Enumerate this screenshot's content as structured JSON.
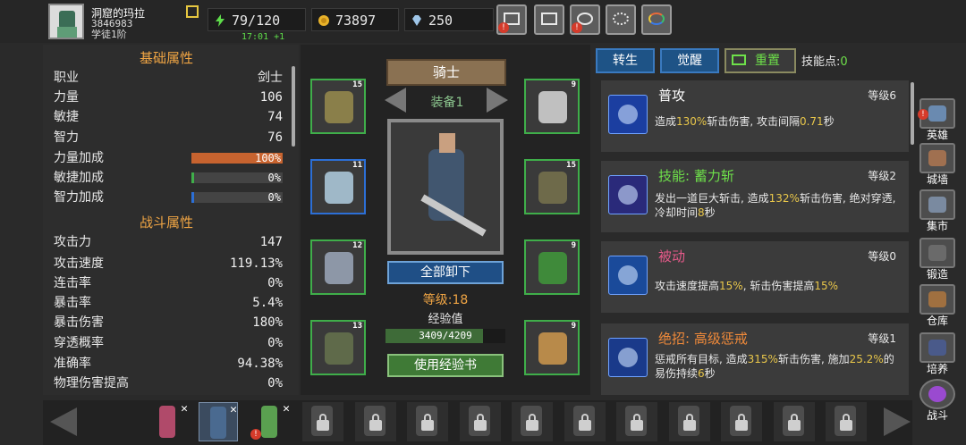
{
  "header": {
    "player_name": "洞窟的玛拉",
    "player_id": "3846983",
    "player_rank": "学徒1阶",
    "stamina": "79/120",
    "gold": "73897",
    "gems": "250",
    "timer": "17:01 +1",
    "icons": [
      "shop-cart-icon",
      "mail-icon",
      "event-icon",
      "settings-gear-icon",
      "color-wheel-icon"
    ]
  },
  "stats": {
    "basic_title": "基础属性",
    "basic": [
      {
        "label": "职业",
        "value": "剑士"
      },
      {
        "label": "力量",
        "value": "106"
      },
      {
        "label": "敏捷",
        "value": "74"
      },
      {
        "label": "智力",
        "value": "76"
      }
    ],
    "bonus": [
      {
        "label": "力量加成",
        "value": "100%",
        "fill": 1.0,
        "color": "#c7632f"
      },
      {
        "label": "敏捷加成",
        "value": "0%",
        "fill": 0.03,
        "color": "#3fae4a"
      },
      {
        "label": "智力加成",
        "value": "0%",
        "fill": 0.03,
        "color": "#2c6fd6"
      }
    ],
    "combat_title": "战斗属性",
    "combat": [
      {
        "label": "攻击力",
        "value": "147"
      },
      {
        "label": "攻击速度",
        "value": "119.13%"
      },
      {
        "label": "连击率",
        "value": "0%"
      },
      {
        "label": "暴击率",
        "value": "5.4%"
      },
      {
        "label": "暴击伤害",
        "value": "180%"
      },
      {
        "label": "穿透概率",
        "value": "0%"
      },
      {
        "label": "准确率",
        "value": "94.38%"
      },
      {
        "label": "物理伤害提高",
        "value": "0%"
      }
    ]
  },
  "equipment": {
    "class_title": "骑士",
    "equip_tab": "装备1",
    "unequip_all": "全部卸下",
    "level_text": "等级:18",
    "exp_label": "经验值",
    "exp_value": "3409/4209",
    "exp_fill": 0.81,
    "use_exp_book": "使用经验书",
    "slots_left": [
      {
        "level": "15",
        "item": "helmet-icon",
        "color": "#8a7f4a"
      },
      {
        "level": "11",
        "item": "chest-armor-icon",
        "color": "#9fb8c8"
      },
      {
        "level": "12",
        "item": "leg-armor-icon",
        "color": "#8d97a7"
      },
      {
        "level": "13",
        "item": "boots-icon",
        "color": "#5f6a4a"
      }
    ],
    "slots_right": [
      {
        "level": "9",
        "item": "amulet-icon",
        "color": "#c0c0c0"
      },
      {
        "level": "15",
        "item": "gloves-icon",
        "color": "#6e6a4a"
      },
      {
        "level": "9",
        "item": "ring-icon",
        "color": "#3f8a3a"
      },
      {
        "level": "9",
        "item": "sword-weapon-icon",
        "color": "#b88a4a"
      }
    ]
  },
  "skills_panel": {
    "tab_rebirth": "转生",
    "tab_awaken": "觉醒",
    "tab_reset": "重置",
    "skill_points_label": "技能点:",
    "skill_points_value": "0",
    "skills": [
      {
        "name": "普攻",
        "name_color": "#ffffff",
        "level": "等级6",
        "desc_parts": [
          "造成",
          "130%",
          "斩击伤害, 攻击间隔",
          "0.71",
          "秒"
        ]
      },
      {
        "name": "技能: 蓄力斩",
        "name_color": "#6ee04a",
        "level": "等级2",
        "desc_parts": [
          "发出一道巨大斩击, 造成",
          "132%",
          "斩击伤害, 绝对穿透, 冷却时间",
          "8",
          "秒"
        ]
      },
      {
        "name": "被动",
        "name_color": "#e65a8a",
        "level": "等级0",
        "desc_parts": [
          "攻击速度提高",
          "15%",
          ", 斩击伤害提高",
          "15%",
          ""
        ]
      },
      {
        "name": "绝招: 高级惩戒",
        "name_color": "#f08a3a",
        "level": "等级1",
        "desc_parts": [
          "惩戒所有目标, 造成",
          "315%",
          "斩击伤害, 施加",
          "25.2%",
          "的易伤持续",
          "6",
          "秒"
        ]
      }
    ]
  },
  "sidebar": [
    {
      "label": "英雄",
      "icon": "hero-icon",
      "color": "#6a8ab0"
    },
    {
      "label": "城墙",
      "icon": "wall-icon",
      "color": "#a07050"
    },
    {
      "label": "集市",
      "icon": "market-icon",
      "color": "#7a8aa0"
    },
    {
      "label": "锻造",
      "icon": "anvil-icon",
      "color": "#6a6a6a"
    },
    {
      "label": "仓库",
      "icon": "warehouse-icon",
      "color": "#a07040"
    },
    {
      "label": "培养",
      "icon": "training-icon",
      "color": "#4a5a8a"
    },
    {
      "label": "战斗",
      "icon": "battle-portal-icon",
      "color": "#9a4ad0"
    }
  ],
  "heroes": [
    {
      "name": "hero-1",
      "color": "#b04a6a",
      "selected": false
    },
    {
      "name": "hero-2",
      "color": "#4a6a90",
      "selected": true
    },
    {
      "name": "hero-3",
      "color": "#5aa050",
      "selected": false
    }
  ],
  "locked_heroes_count": 11
}
